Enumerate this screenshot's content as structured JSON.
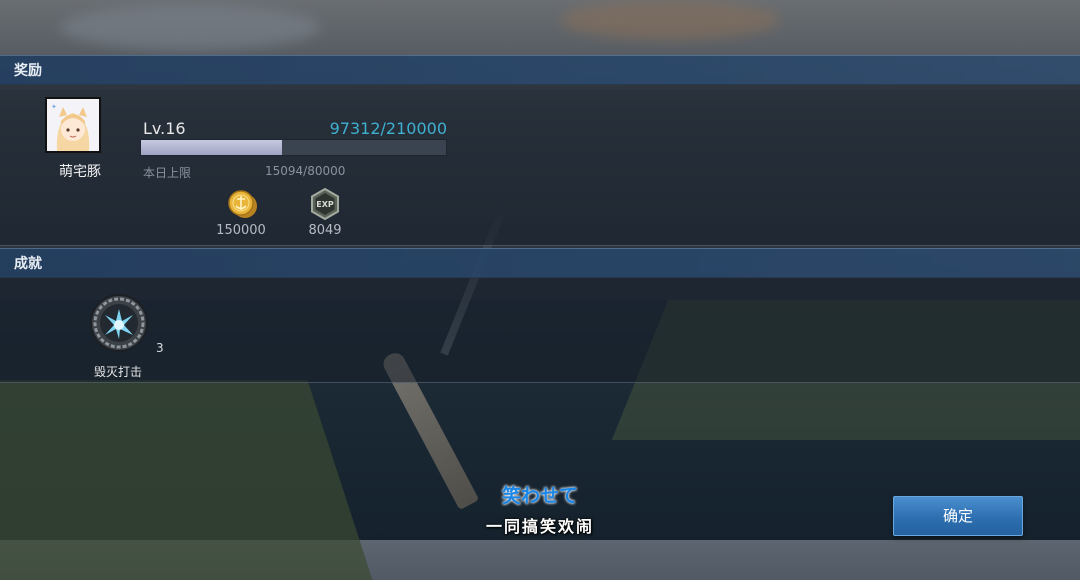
{
  "rewards_section": {
    "title": "奖励",
    "player_name": "萌宅豚",
    "level": "Lv.16",
    "exp_progress": "97312/210000",
    "exp_fraction": 0.463,
    "daily_limit_label": "本日上限",
    "daily_limit_value": "15094/80000",
    "items": [
      {
        "icon": "gold-coin-icon",
        "value": "150000"
      },
      {
        "icon": "exp-badge-icon",
        "value": "8049"
      }
    ]
  },
  "achievements_section": {
    "title": "成就",
    "items": [
      {
        "icon": "destruction-strike-icon",
        "count": "3",
        "name": "毁灭打击"
      }
    ]
  },
  "subtitles": {
    "japanese": "笑わせて",
    "chinese": "一同搞笑欢闹"
  },
  "confirm_button": "确定",
  "colors": {
    "accent": "#3fb0d0",
    "header_band": "#284669",
    "button": "#2d6fb0"
  }
}
